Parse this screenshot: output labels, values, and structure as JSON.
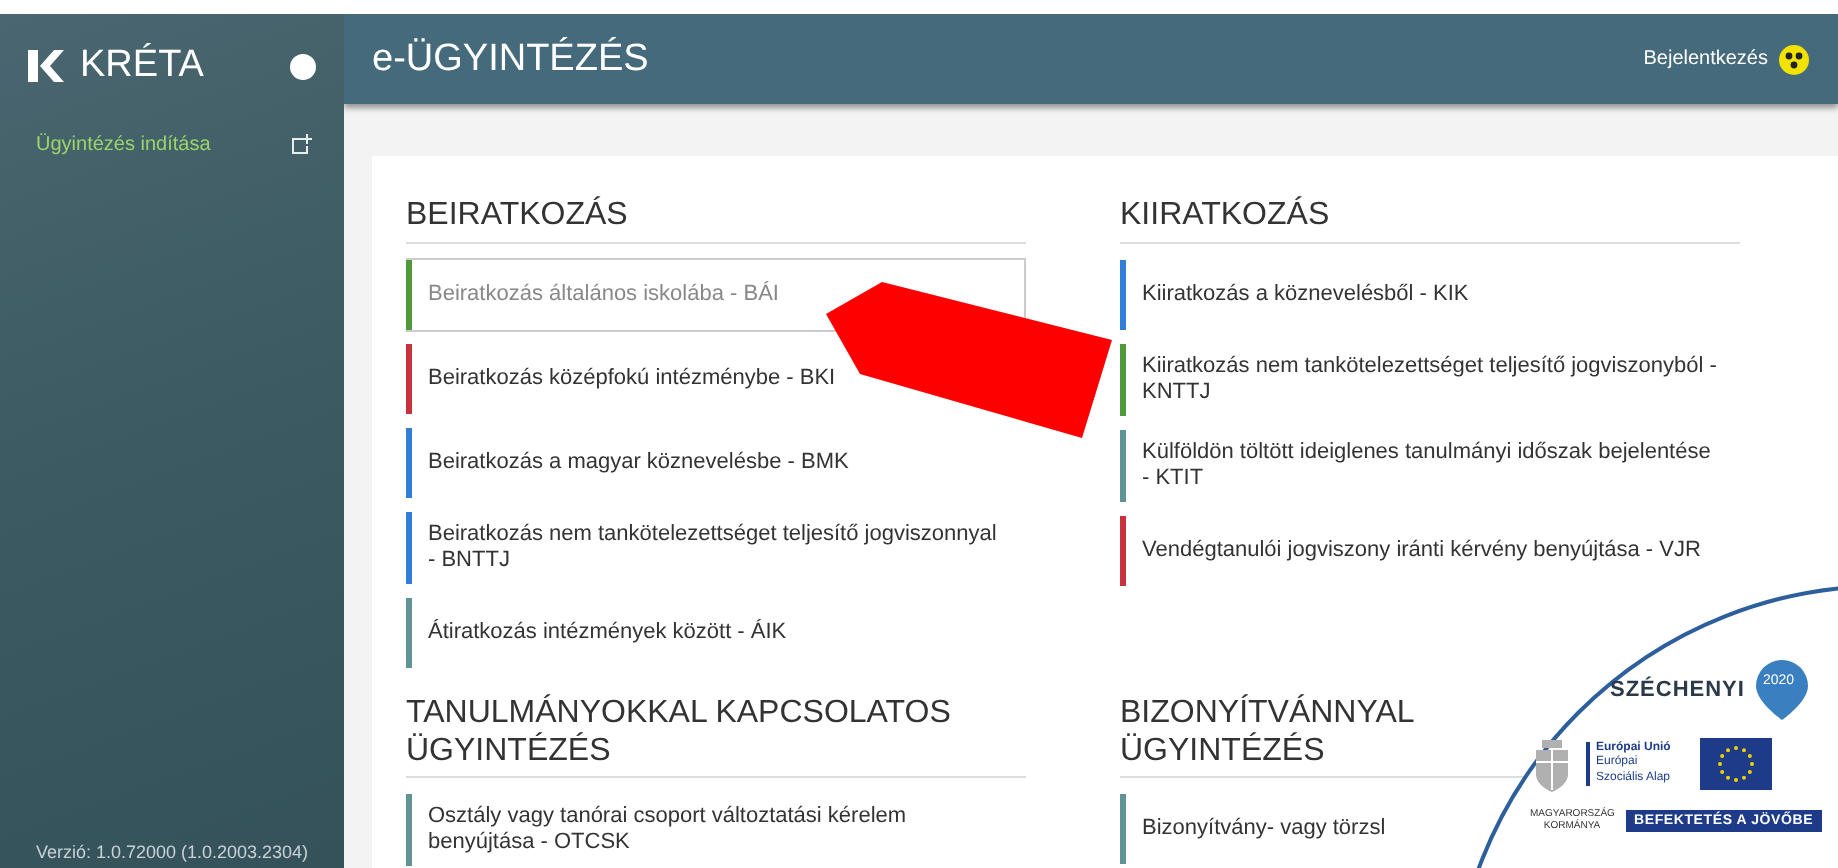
{
  "sidebar": {
    "brand": "KRÉTA",
    "items": [
      {
        "label": "Ügyintézés indítása",
        "selected": true
      }
    ],
    "version": "Verzió: 1.0.72000 (1.0.2003.2304)"
  },
  "header": {
    "title": "e-ÜGYINTÉZÉS",
    "login": "Bejelentkezés"
  },
  "sections": [
    {
      "title": "BEIRATKOZÁS",
      "items": [
        {
          "label": "Beiratkozás általános iskolába - BÁI",
          "color": "#4e9a3a",
          "selected": true
        },
        {
          "label": "Beiratkozás középfokú intézménybe - BKI",
          "color": "#c8323c",
          "selected": false
        },
        {
          "label": "Beiratkozás a magyar köznevelésbe - BMK",
          "color": "#2f7fd8",
          "selected": false
        },
        {
          "label": "Beiratkozás nem tankötelezettséget teljesítő jogviszonnyal - BNTTJ",
          "color": "#2f7fd8",
          "selected": false
        },
        {
          "label": "Átiratkozás intézmények között - ÁIK",
          "color": "#5e9494",
          "selected": false
        }
      ]
    },
    {
      "title": "KIIRATKOZÁS",
      "items": [
        {
          "label": "Kiiratkozás a köznevelésből - KIK",
          "color": "#2f7fd8",
          "selected": false
        },
        {
          "label": "Kiiratkozás nem tankötelezettséget teljesítő jogviszonyból - KNTTJ",
          "color": "#4e9a3a",
          "selected": false
        },
        {
          "label": "Külföldön töltött ideiglenes tanulmányi időszak bejelentése - KTIT",
          "color": "#5e9494",
          "selected": false
        },
        {
          "label": "Vendégtanulói jogviszony iránti kérvény benyújtása - VJR",
          "color": "#c8323c",
          "selected": false
        }
      ]
    },
    {
      "title": "TANULMÁNYOKKAL KAPCSOLATOS\nÜGYINTÉZÉS",
      "items": [
        {
          "label": "Osztály vagy tanórai csoport változtatási kérelem benyújtása - OTCSK",
          "color": "#5e9494",
          "selected": false
        }
      ]
    },
    {
      "title": "BIZONYÍTVÁNNYAL\nÜGYINTÉZÉS",
      "items": [
        {
          "label": "Bizonyítvány- vagy törzsl",
          "color": "#5e9494",
          "selected": false
        }
      ]
    }
  ],
  "badge": {
    "brand": "SZÉCHENYI",
    "year": "2020",
    "eu_title": "Európai Unió",
    "eu_sub": "Európai Szociális Alap",
    "gov": "MAGYARORSZÁG KORMÁNYA",
    "slogan": "BEFEKTETÉS A JÖVŐBE"
  }
}
